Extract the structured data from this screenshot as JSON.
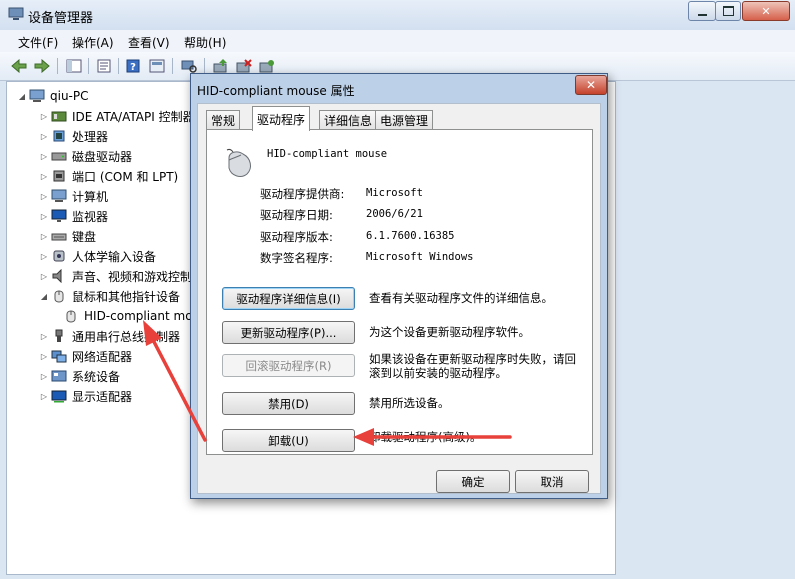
{
  "window": {
    "title": "设备管理器",
    "caption": {
      "minimize": "▭",
      "maximize": "□",
      "close": "✕"
    }
  },
  "menu": [
    "文件(F)",
    "操作(A)",
    "查看(V)",
    "帮助(H)"
  ],
  "tree": {
    "root": "qiu-PC",
    "items": [
      {
        "label": "IDE ATA/ATAPI 控制器",
        "icon": "ide-controller-icon",
        "expanded": false
      },
      {
        "label": "处理器",
        "icon": "processor-icon",
        "expanded": false
      },
      {
        "label": "磁盘驱动器",
        "icon": "disk-drive-icon",
        "expanded": false
      },
      {
        "label": "端口 (COM 和 LPT)",
        "icon": "port-icon",
        "expanded": false
      },
      {
        "label": "计算机",
        "icon": "computer-icon",
        "expanded": false
      },
      {
        "label": "监视器",
        "icon": "monitor-icon",
        "expanded": false
      },
      {
        "label": "键盘",
        "icon": "keyboard-icon",
        "expanded": false
      },
      {
        "label": "人体学输入设备",
        "icon": "hid-icon",
        "expanded": false
      },
      {
        "label": "声音、视频和游戏控制器",
        "icon": "sound-icon",
        "expanded": false
      },
      {
        "label": "鼠标和其他指针设备",
        "icon": "mouse-icon",
        "expanded": true
      },
      {
        "label": "HID-compliant mouse",
        "icon": "mouse-icon",
        "child": true
      },
      {
        "label": "通用串行总线控制器",
        "icon": "usb-icon",
        "expanded": false
      },
      {
        "label": "网络适配器",
        "icon": "network-icon",
        "expanded": false
      },
      {
        "label": "系统设备",
        "icon": "system-icon",
        "expanded": false
      },
      {
        "label": "显示适配器",
        "icon": "display-adapter-icon",
        "expanded": false
      }
    ]
  },
  "dialog": {
    "title": "HID-compliant mouse 属性",
    "tabs": [
      "常规",
      "驱动程序",
      "详细信息",
      "电源管理"
    ],
    "active_tab": "驱动程序",
    "device_name": "HID-compliant mouse",
    "info": [
      {
        "label": "驱动程序提供商:",
        "value": "Microsoft"
      },
      {
        "label": "驱动程序日期:",
        "value": "2006/6/21"
      },
      {
        "label": "驱动程序版本:",
        "value": "6.1.7600.16385"
      },
      {
        "label": "数字签名程序:",
        "value": "Microsoft Windows"
      }
    ],
    "actions": [
      {
        "button": "驱动程序详细信息(I)",
        "desc": "查看有关驱动程序文件的详细信息。",
        "disabled": false
      },
      {
        "button": "更新驱动程序(P)...",
        "desc": "为这个设备更新驱动程序软件。",
        "disabled": false
      },
      {
        "button": "回滚驱动程序(R)",
        "desc": "如果该设备在更新驱动程序时失败，请回滚到以前安装的驱动程序。",
        "disabled": true
      },
      {
        "button": "禁用(D)",
        "desc": "禁用所选设备。",
        "disabled": false
      },
      {
        "button": "卸载(U)",
        "desc": "卸载驱动程序(高级)。",
        "disabled": false
      }
    ],
    "ok": "确定",
    "cancel": "取消"
  },
  "colors": {
    "accent": "#3f5c86",
    "annotation_arrow": "#e8403a"
  }
}
